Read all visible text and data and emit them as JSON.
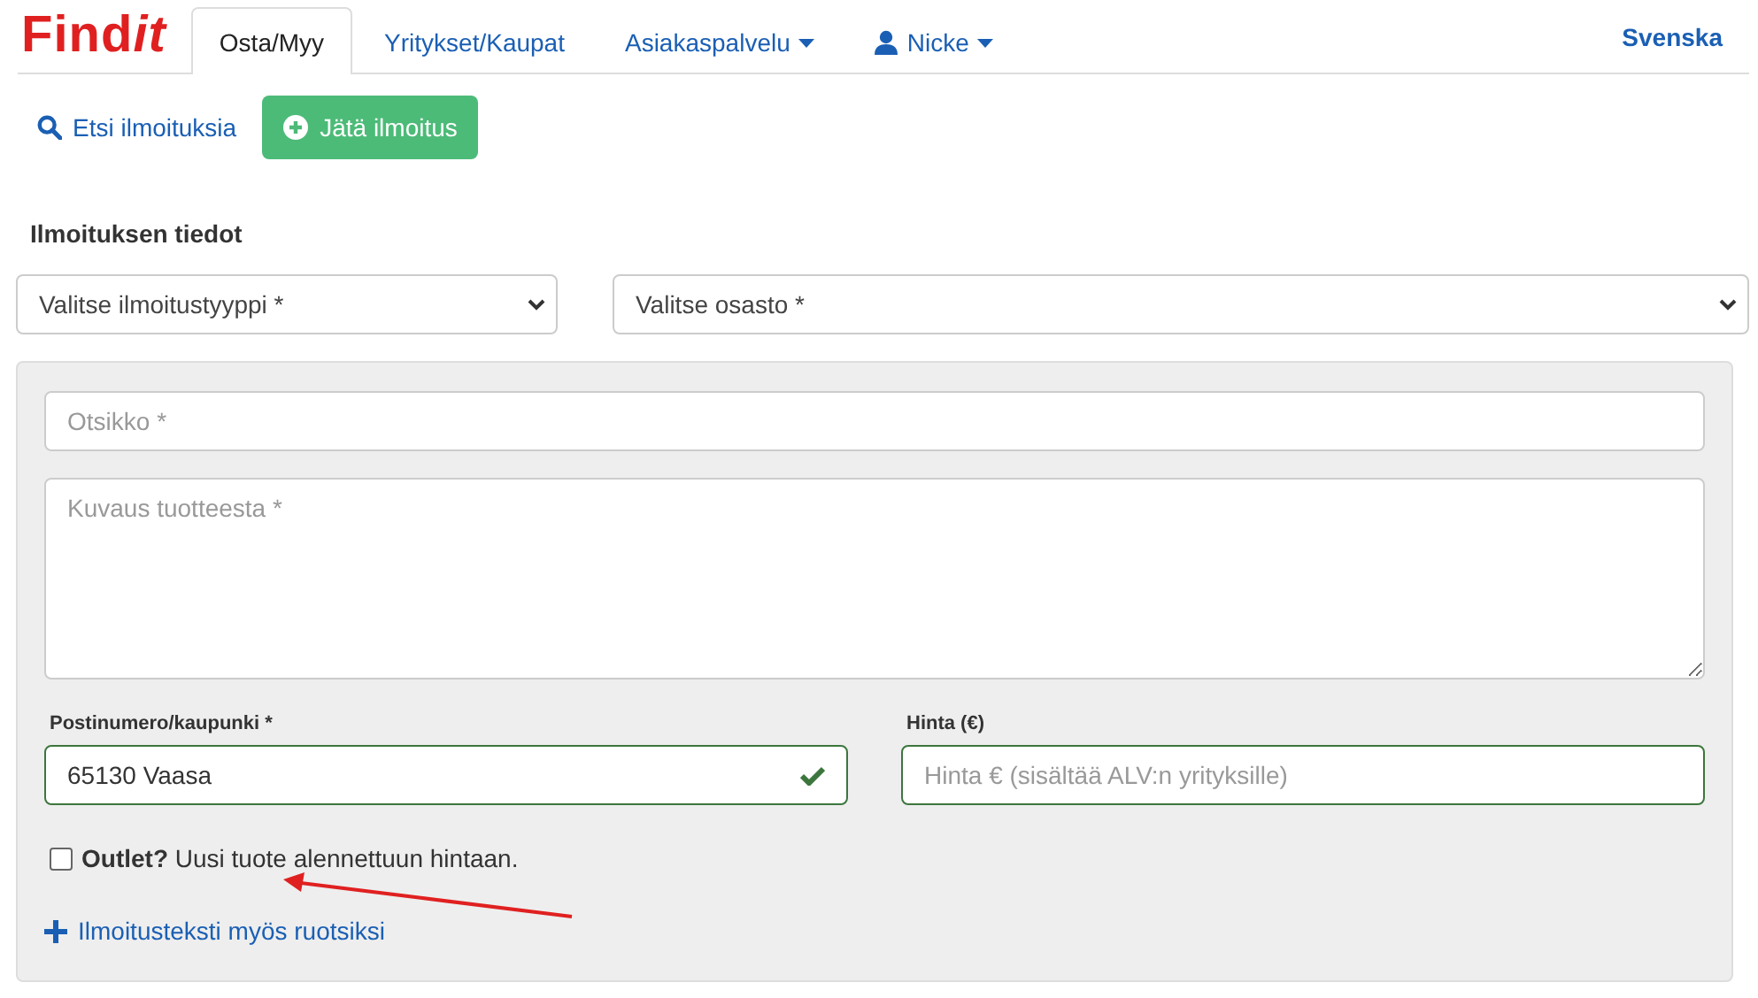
{
  "logo": [
    {
      "text": "Find",
      "italic": false
    },
    {
      "text": "it",
      "italic": true
    }
  ],
  "nav": {
    "tabs": [
      {
        "label": "Osta/Myy",
        "selected": true,
        "kind": "plain"
      },
      {
        "label": "Yritykset/Kaupat",
        "selected": false,
        "kind": "plain"
      },
      {
        "label": "Asiakaspalvelu",
        "selected": false,
        "kind": "dropdown"
      },
      {
        "label": "Nicke",
        "selected": false,
        "kind": "user"
      }
    ],
    "language": "Svenska"
  },
  "actions": {
    "search_link": "Etsi ilmoituksia",
    "new_ad_button": "Jätä ilmoitus"
  },
  "section_title": "Ilmoituksen tiedot",
  "selects": [
    {
      "placeholder": "Valitse ilmoitustyyppi *"
    },
    {
      "placeholder": "Valitse osasto *"
    }
  ],
  "form": {
    "title_field": {
      "placeholder": "Otsikko *"
    },
    "description_field": {
      "placeholder": "Kuvaus tuotteesta *"
    },
    "location": {
      "label": "Postinumero/kaupunki *",
      "value": "65130 Vaasa",
      "valid": true
    },
    "price": {
      "label": "Hinta (€)",
      "placeholder": "Hinta € (sisältää ALV:n yrityksille)"
    },
    "outlet": {
      "checked": false,
      "label": "**Outlet?** Uusi tuote alennettuun hintaan."
    },
    "swedish_link": "Ilmoitusteksti myös ruotsiksi"
  }
}
